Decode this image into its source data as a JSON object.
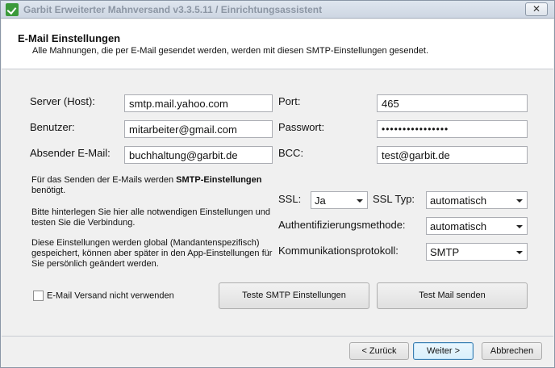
{
  "window": {
    "title": "Garbit Erweiterter Mahnversand v3.3.5.11 / Einrichtungsassistent",
    "close_label": "✕"
  },
  "header": {
    "title": "E-Mail Einstellungen",
    "subtitle": "Alle Mahnungen, die per E-Mail gesendet werden, werden mit diesen SMTP-Einstellungen gesendet."
  },
  "form": {
    "server_label": "Server (Host):",
    "server_value": "smtp.mail.yahoo.com",
    "port_label": "Port:",
    "port_value": "465",
    "user_label": "Benutzer:",
    "user_value": "mitarbeiter@gmail.com",
    "password_label": "Passwort:",
    "password_value": "••••••••••••••••",
    "sender_label": "Absender E-Mail:",
    "sender_value": "buchhaltung@garbit.de",
    "bcc_label": "BCC:",
    "bcc_value": "test@garbit.de",
    "ssl_label": "SSL:",
    "ssl_value": "Ja",
    "ssl_type_label": "SSL Typ:",
    "ssl_type_value": "automatisch",
    "auth_label": "Authentifizierungsmethode:",
    "auth_value": "automatisch",
    "protocol_label": "Kommunikationsprotokoll:",
    "protocol_value": "SMTP"
  },
  "info": {
    "p1_prefix": "Für das Senden der E-Mails werden ",
    "p1_bold": "SMTP-Einstellungen",
    "p1_suffix": " benötigt.",
    "p2": "Bitte hinterlegen Sie hier alle notwendigen Einstellungen und testen Sie die Verbindung.",
    "p3": "Diese Einstellungen werden global (Mandantenspezifisch) gespeichert, können aber später in den App-Einstellungen für Sie persönlich geändert werden."
  },
  "options": {
    "disable_email_label": "E-Mail Versand nicht verwenden",
    "disable_email_checked": false
  },
  "buttons": {
    "test_smtp": "Teste SMTP Einstellungen",
    "test_mail": "Test Mail senden",
    "back": "< Zurück",
    "next": "Weiter >",
    "cancel": "Abbrechen"
  }
}
